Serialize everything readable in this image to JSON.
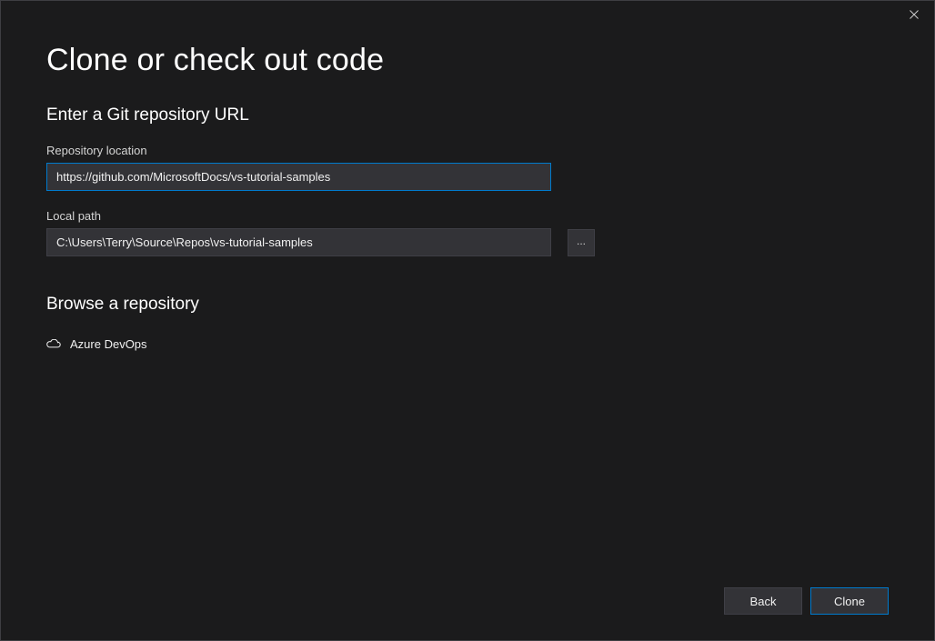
{
  "titlebar": {
    "close_label": "Close"
  },
  "page": {
    "title": "Clone or check out code",
    "section_enter_url": "Enter a Git repository URL",
    "section_browse": "Browse a repository"
  },
  "fields": {
    "repo_location_label": "Repository location",
    "repo_location_value": "https://github.com/MicrosoftDocs/vs-tutorial-samples",
    "local_path_label": "Local path",
    "local_path_value": "C:\\Users\\Terry\\Source\\Repos\\vs-tutorial-samples",
    "browse_button_label": "..."
  },
  "browse": {
    "items": [
      {
        "label": "Azure DevOps",
        "icon": "cloud-icon"
      }
    ]
  },
  "footer": {
    "back_label": "Back",
    "clone_label": "Clone"
  }
}
